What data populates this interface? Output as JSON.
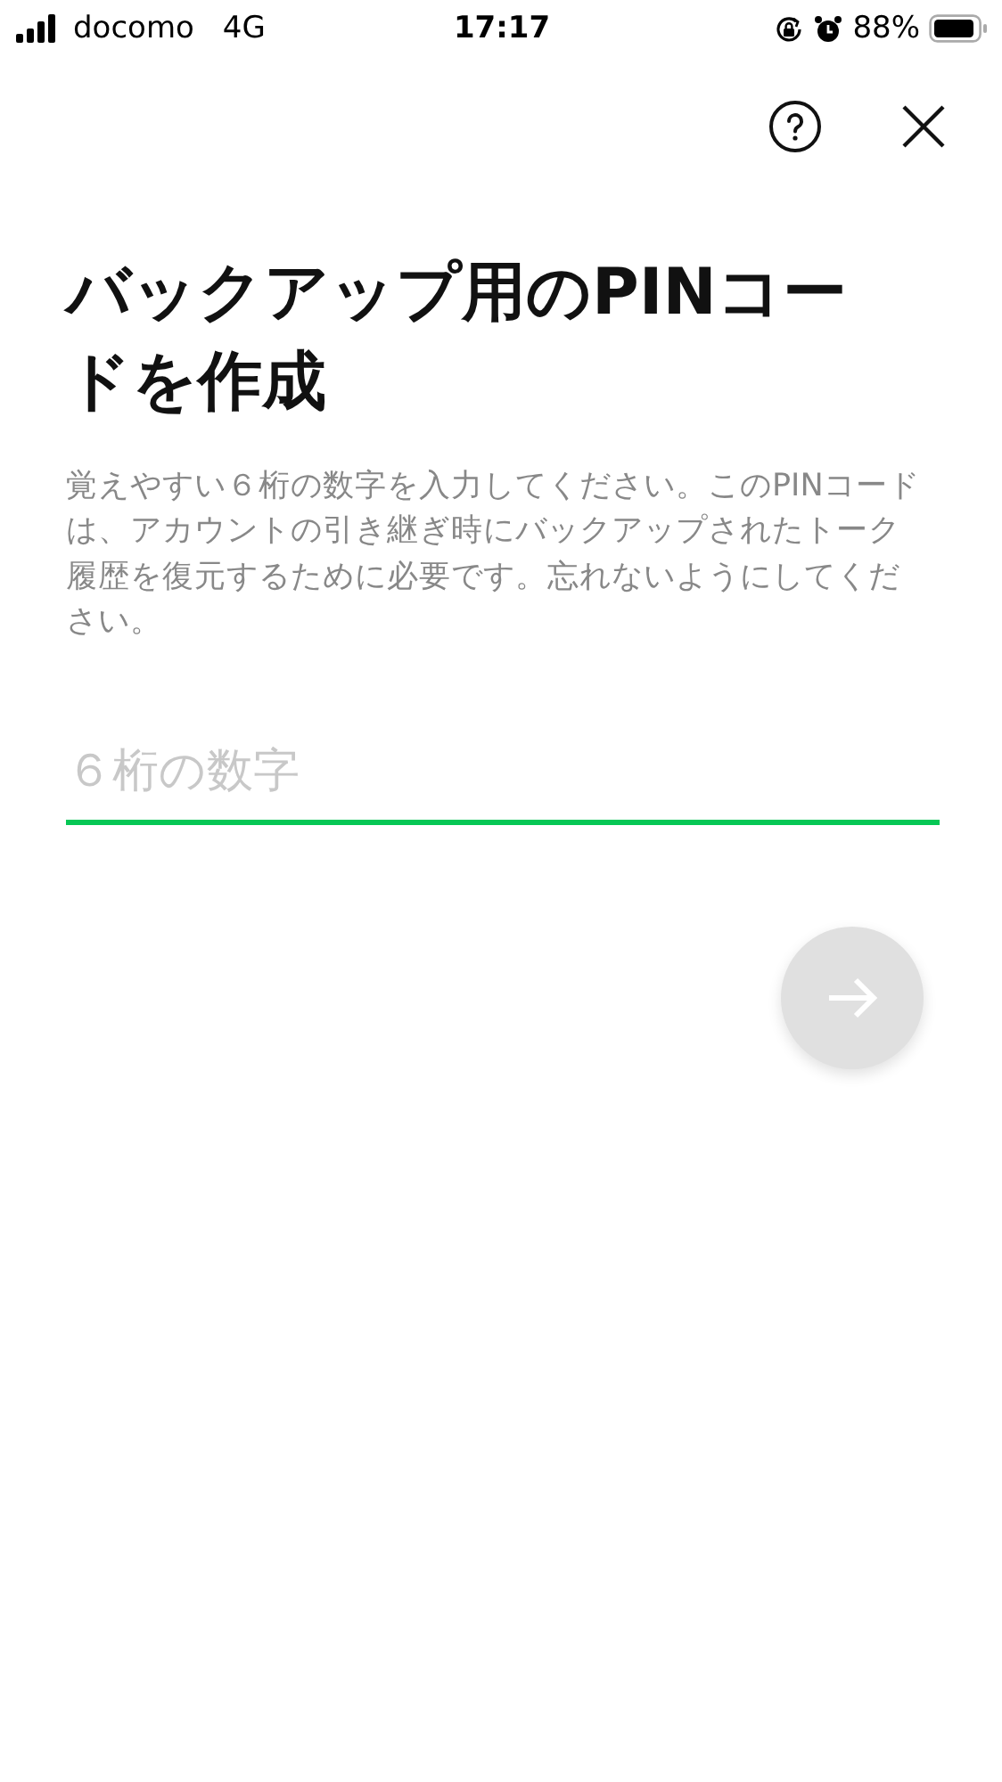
{
  "status_bar": {
    "carrier": "docomo",
    "network": "4G",
    "time": "17:17",
    "battery": "88%"
  },
  "title": "バックアップ用のPINコードを作成",
  "description": "覚えやすい６桁の数字を入力してください。このPINコードは、アカウントの引き継ぎ時にバックアップされたトーク履歴を復元するために必要です。忘れないようにしてください。",
  "pin_field": {
    "placeholder": "６桁の数字"
  },
  "next_button": {
    "disabled": true
  }
}
